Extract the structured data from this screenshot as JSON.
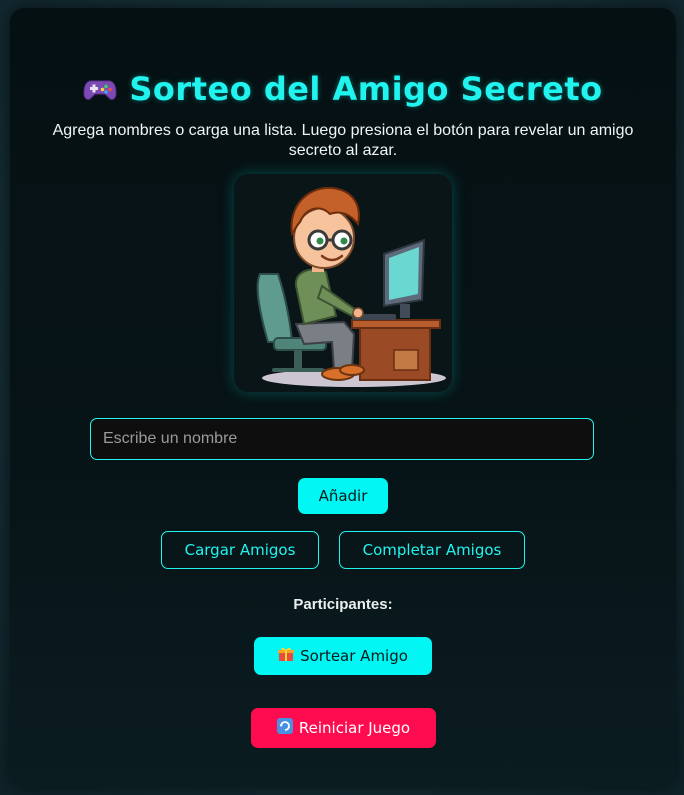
{
  "header": {
    "title": "Sorteo del Amigo Secreto",
    "title_icon": "gamepad-icon",
    "subtitle": "Agrega nombres o carga una lista. Luego presiona el botón para revelar un amigo secreto al azar."
  },
  "avatar": {
    "icon": "cartoon-boy-at-computer-illustration"
  },
  "name_input": {
    "value": "",
    "placeholder": "Escribe un nombre"
  },
  "buttons": {
    "add_label": "Añadir",
    "load_label": "Cargar Amigos",
    "complete_label": "Completar Amigos",
    "draw_label": "Sortear Amigo",
    "draw_icon": "gift-icon",
    "reset_label": "Reiniciar Juego",
    "reset_icon": "refresh-icon"
  },
  "participants": {
    "heading": "Participantes:",
    "items": []
  },
  "colors": {
    "accent": "#00f7f3",
    "danger": "#ff0b4f",
    "card_bg": "#051013"
  }
}
